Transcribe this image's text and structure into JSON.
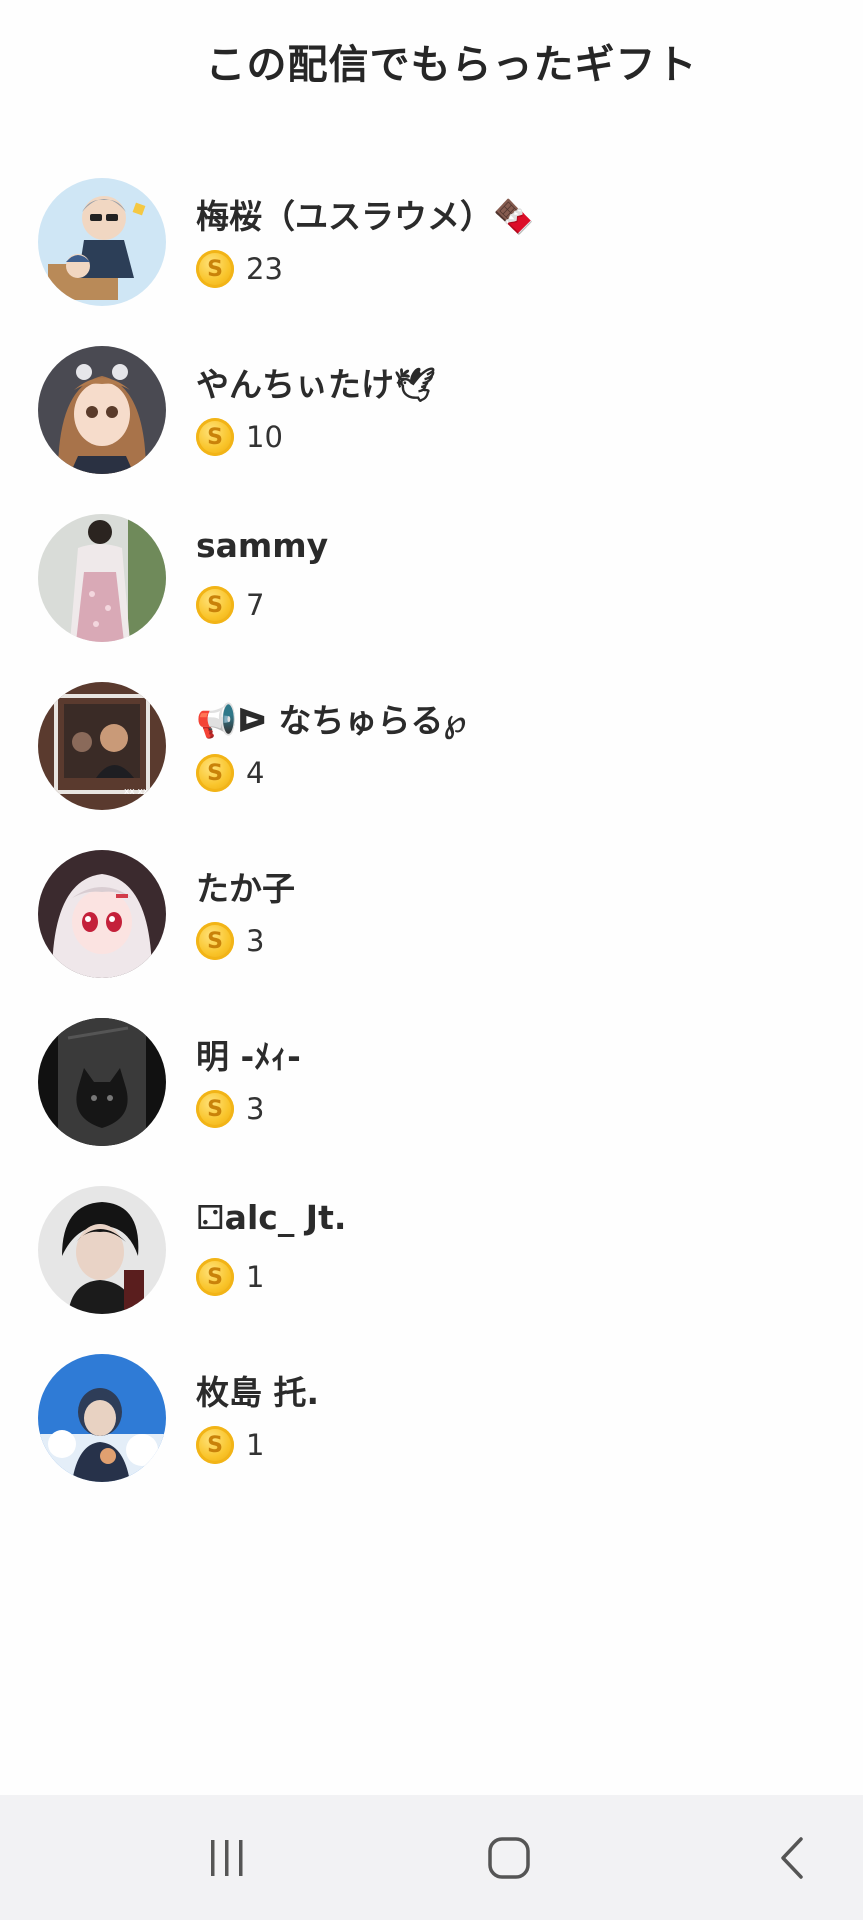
{
  "header": {
    "title": "この配信でもらったギフト"
  },
  "gifters": [
    {
      "name": "梅桜（ユスラウメ）🍫",
      "count": "23",
      "avatar_icon": "avatar-illustrated-man-with-glasses"
    },
    {
      "name": "やんちぃたけ🕊",
      "count": "10",
      "avatar_icon": "avatar-anime-girl"
    },
    {
      "name": "sammy",
      "count": "7",
      "avatar_icon": "avatar-photo-woman-dress"
    },
    {
      "name": "📢ᐅ なちゅらる℘",
      "count": "4",
      "avatar_icon": "avatar-photo-frame"
    },
    {
      "name": "たか子",
      "count": "3",
      "avatar_icon": "avatar-anime-girl-white-hair"
    },
    {
      "name": "明 -ﾒｨ-",
      "count": "3",
      "avatar_icon": "avatar-black-cat"
    },
    {
      "name": "⚁alc_ Jt.",
      "count": "1",
      "avatar_icon": "avatar-dark-haired-boy"
    },
    {
      "name": "枚島 托.",
      "count": "1",
      "avatar_icon": "avatar-blue-sky-boy"
    }
  ],
  "coin_symbol": "S",
  "colors": {
    "coin": "#f9c42a",
    "navbar": "#f2f2f4"
  },
  "navbar": {
    "icons": [
      "recent-apps-icon",
      "home-icon",
      "back-icon"
    ]
  }
}
